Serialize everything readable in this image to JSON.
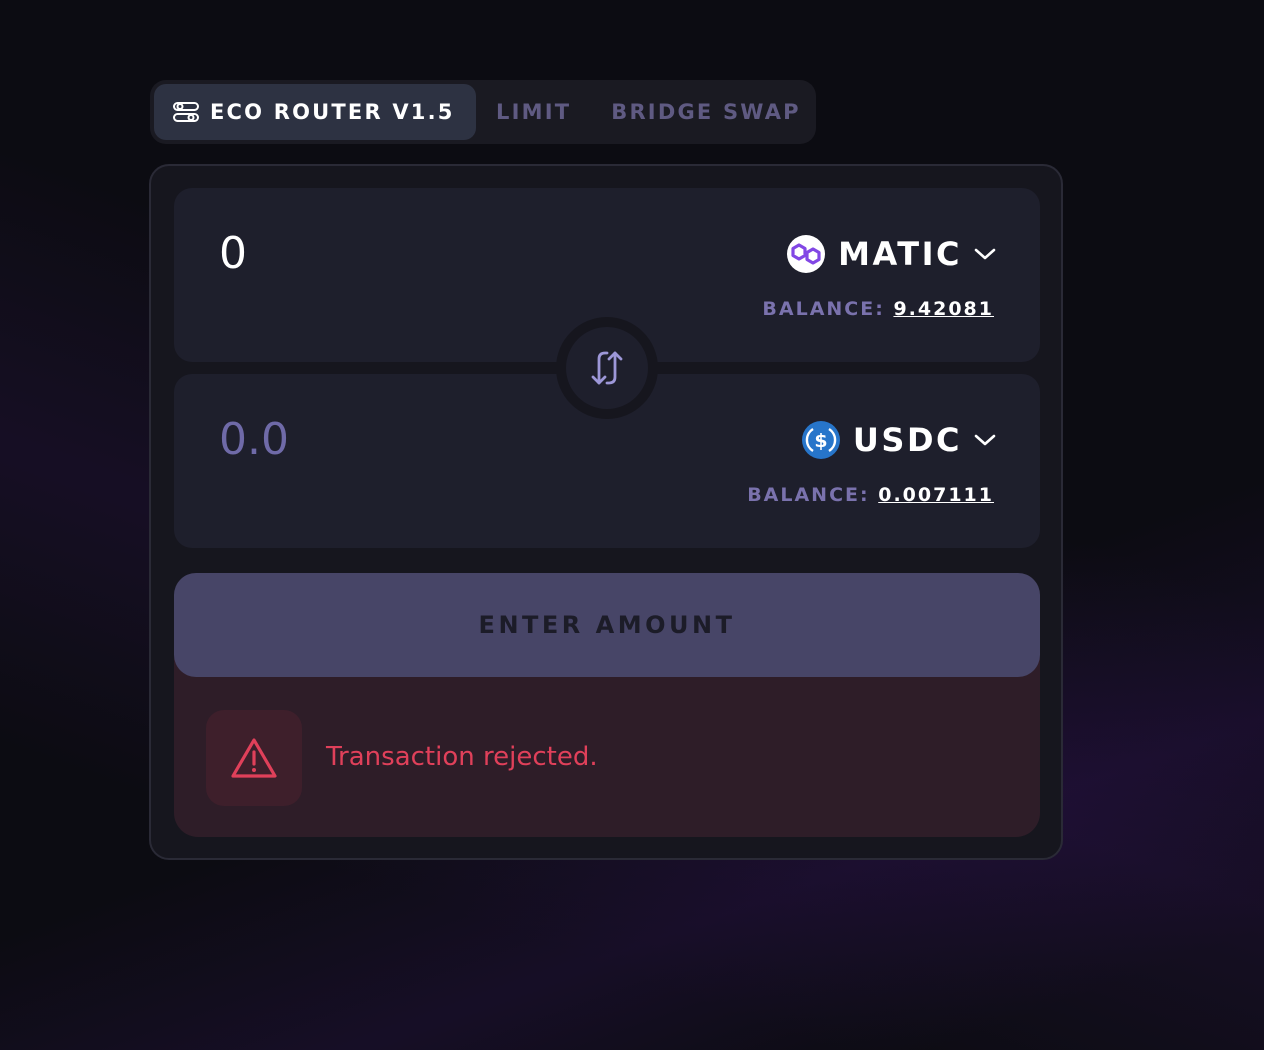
{
  "tabs": [
    {
      "label": "ECO ROUTER V1.5",
      "icon": "route-settings-icon",
      "active": true
    },
    {
      "label": "LIMIT",
      "active": false
    },
    {
      "label": "BRIDGE SWAP",
      "active": false
    }
  ],
  "from": {
    "amount": "0",
    "token": "MATIC",
    "token_icon": "polygon-matic-icon",
    "balance_label": "BALANCE:",
    "balance_value": "9.42081"
  },
  "to": {
    "amount": "0.0",
    "token": "USDC",
    "token_icon": "usdc-icon",
    "balance_label": "BALANCE:",
    "balance_value": "0.007111"
  },
  "swap_icon": "swap-arrows-icon",
  "action_button": "ENTER AMOUNT",
  "error": {
    "icon": "warning-icon",
    "message": "Transaction rejected."
  },
  "colors": {
    "accent": "#7a72ad",
    "error": "#e0405a",
    "matic": "#8247e5",
    "usdc": "#2775ca"
  }
}
